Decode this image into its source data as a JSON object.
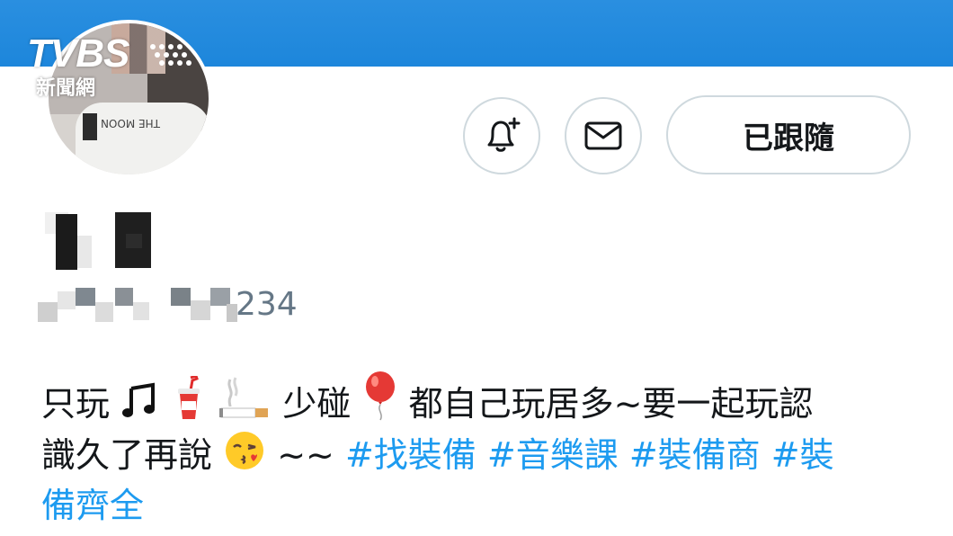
{
  "watermark": {
    "brand": "TVBS",
    "sub": "新聞網"
  },
  "profile": {
    "handle_suffix": "234",
    "follow_button": "已跟隨",
    "notify_icon": "bell-plus-icon",
    "message_icon": "mail-icon"
  },
  "bio": {
    "line1": {
      "t1": "只玩",
      "t2": "少碰",
      "t3": " 都自己玩居多~要一起玩認"
    },
    "line2": {
      "t1": "識久了再說",
      "t2": " ~~ ",
      "tags": [
        "#找裝備",
        "#音樂課",
        "#裝備商",
        "#裝"
      ]
    },
    "line3": {
      "tag_cont": "備齊全"
    },
    "emojis": [
      "music-notes-emoji",
      "cup-with-straw-emoji",
      "cigarette-emoji",
      "balloon-emoji",
      "kiss-face-emoji"
    ]
  },
  "colors": {
    "banner": "#1d86db",
    "hashtag": "#1d9bf0",
    "text": "#14171a",
    "muted": "#657786",
    "border": "#cfd9de"
  }
}
